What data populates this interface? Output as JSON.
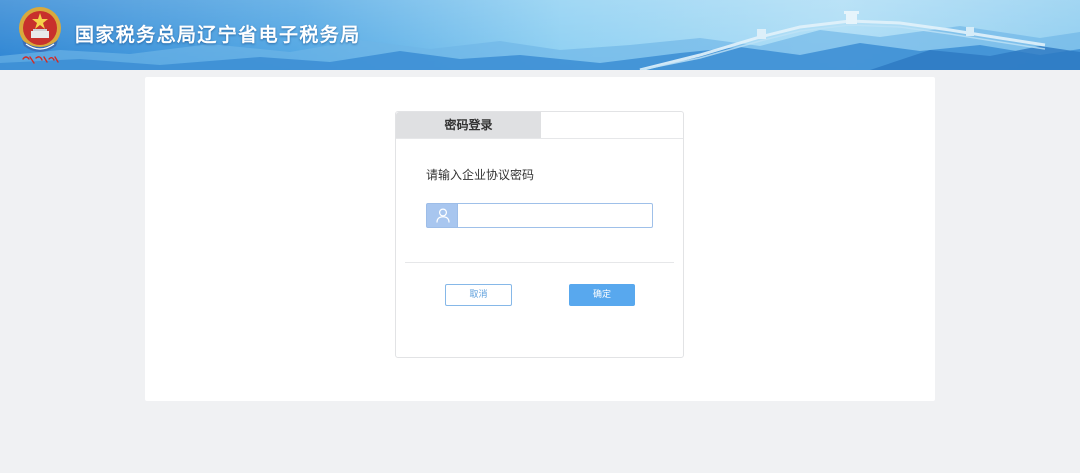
{
  "header": {
    "title": "国家税务总局辽宁省电子税务局",
    "logo_icon": "tax-emblem-icon",
    "banner_image": "great-wall-mountains"
  },
  "login": {
    "tabs": [
      {
        "label": "密码登录",
        "active": true
      }
    ],
    "prompt": "请输入企业协议密码",
    "password_field": {
      "value": "",
      "icon": "user-icon"
    },
    "cancel_label": "取消",
    "confirm_label": "确定"
  },
  "colors": {
    "header_blue": "#2b84d3",
    "accent_blue": "#58a8ee",
    "input_border": "#9fc0e9",
    "page_background": "#f0f1f3",
    "active_tab": "#dfe0e2"
  }
}
